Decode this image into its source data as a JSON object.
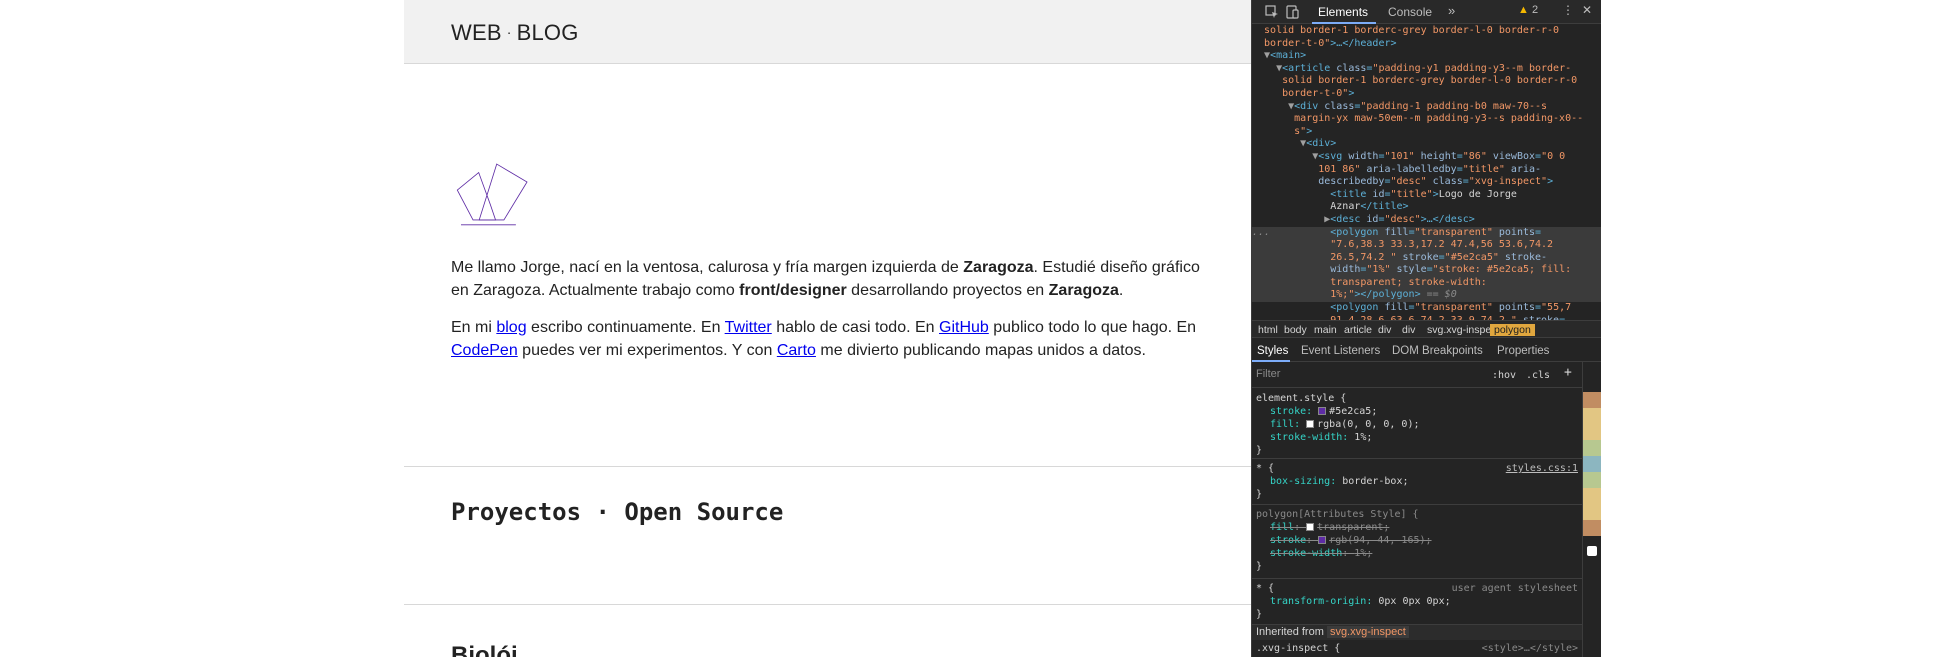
{
  "site": {
    "title_left": "WEB",
    "title_dot": "·",
    "title_right": "BLOG"
  },
  "logo": {
    "name": "Logo de Jorge Aznar",
    "stroke_color": "#5e2ca5"
  },
  "intro": {
    "p1": [
      {
        "t": "Me llamo Jorge, nací en la ventosa, calurosa y fría margen izquierda de "
      },
      {
        "t": "Zaragoza",
        "b": true
      },
      {
        "t": ". Estudié diseño gráfico en Zaragoza. Actualmente trabajo como "
      },
      {
        "t": "front/designer",
        "b": true
      },
      {
        "t": " desarrollando proyectos en "
      },
      {
        "t": "Zaragoza",
        "b": true
      },
      {
        "t": "."
      }
    ],
    "p2": [
      {
        "t": "En mi "
      },
      {
        "t": "blog",
        "link": true
      },
      {
        "t": " escribo continuamente. En "
      },
      {
        "t": "Twitter",
        "link": true
      },
      {
        "t": " hablo de casi todo. En "
      },
      {
        "t": "GitHub",
        "link": true
      },
      {
        "t": " publico todo lo que hago. En "
      },
      {
        "t": "CodePen",
        "link": true
      },
      {
        "t": " puedes ver mi experimentos. Y con "
      },
      {
        "t": "Carto",
        "link": true
      },
      {
        "t": " me divierto publicando mapas unidos a datos."
      }
    ]
  },
  "sections": {
    "projects_title": "Proyectos · Open Source",
    "next_title": "Biolói"
  },
  "devtools": {
    "tabs": {
      "elements": "Elements",
      "console": "Console",
      "more": "»",
      "warnings": "2",
      "kebab": "⋮",
      "close": "✕"
    },
    "dom_lines": [
      [
        {
          "c": "aval",
          "t": "  solid border-1 borderc-grey border-l-0 border-r-0"
        }
      ],
      [
        {
          "c": "aval",
          "t": "  border-t-0\""
        },
        {
          "c": "tag",
          "t": ">…</header>"
        }
      ],
      [
        {
          "c": "tri2",
          "t": "  ▼"
        },
        {
          "c": "tag",
          "t": "<main>"
        }
      ],
      [
        {
          "c": "tri2",
          "t": "    ▼"
        },
        {
          "c": "tag",
          "t": "<article "
        },
        {
          "c": "attr",
          "t": "class"
        },
        {
          "c": "tag",
          "t": "="
        },
        {
          "c": "aval",
          "t": "\"padding-y1 padding-y3--m border-"
        }
      ],
      [
        {
          "c": "aval",
          "t": "     solid border-1 borderc-grey border-l-0 border-r-0"
        }
      ],
      [
        {
          "c": "aval",
          "t": "     border-t-0\""
        },
        {
          "c": "tag",
          "t": ">"
        }
      ],
      [
        {
          "c": "tri2",
          "t": "      ▼"
        },
        {
          "c": "tag",
          "t": "<div "
        },
        {
          "c": "attr",
          "t": "class"
        },
        {
          "c": "tag",
          "t": "="
        },
        {
          "c": "aval",
          "t": "\"padding-1 padding-b0 maw-70--s"
        }
      ],
      [
        {
          "c": "aval",
          "t": "       margin-yx maw-50em--m padding-y3--s padding-x0--"
        }
      ],
      [
        {
          "c": "aval",
          "t": "       s\""
        },
        {
          "c": "tag",
          "t": ">"
        }
      ],
      [
        {
          "c": "tri2",
          "t": "        ▼"
        },
        {
          "c": "tag",
          "t": "<div>"
        }
      ],
      [
        {
          "c": "tri2",
          "t": "          ▼"
        },
        {
          "c": "tag",
          "t": "<svg "
        },
        {
          "c": "attr",
          "t": "width"
        },
        {
          "c": "tag",
          "t": "="
        },
        {
          "c": "aval",
          "t": "\"101\" "
        },
        {
          "c": "attr",
          "t": "height"
        },
        {
          "c": "tag",
          "t": "="
        },
        {
          "c": "aval",
          "t": "\"86\" "
        },
        {
          "c": "attr",
          "t": "viewBox"
        },
        {
          "c": "tag",
          "t": "="
        },
        {
          "c": "aval",
          "t": "\"0 0"
        }
      ],
      [
        {
          "c": "aval",
          "t": "           101 86\" "
        },
        {
          "c": "attr",
          "t": "aria-labelledby"
        },
        {
          "c": "tag",
          "t": "="
        },
        {
          "c": "aval",
          "t": "\"title\" "
        },
        {
          "c": "attr",
          "t": "aria-"
        }
      ],
      [
        {
          "c": "attr",
          "t": "           describedby"
        },
        {
          "c": "tag",
          "t": "="
        },
        {
          "c": "aval",
          "t": "\"desc\" "
        },
        {
          "c": "attr",
          "t": "class"
        },
        {
          "c": "tag",
          "t": "="
        },
        {
          "c": "aval",
          "t": "\"xvg-inspect\""
        },
        {
          "c": "tag",
          "t": ">"
        }
      ],
      [
        {
          "c": "tag",
          "t": "             <title "
        },
        {
          "c": "attr",
          "t": "id"
        },
        {
          "c": "tag",
          "t": "="
        },
        {
          "c": "aval",
          "t": "\"title\""
        },
        {
          "c": "tag",
          "t": ">"
        },
        {
          "c": "txt",
          "t": "Logo de Jorge"
        }
      ],
      [
        {
          "c": "txt",
          "t": "             Aznar"
        },
        {
          "c": "tag",
          "t": "</title>"
        }
      ],
      [
        {
          "c": "tri2",
          "t": "            ▶"
        },
        {
          "c": "tag",
          "t": "<desc "
        },
        {
          "c": "attr",
          "t": "id"
        },
        {
          "c": "tag",
          "t": "="
        },
        {
          "c": "aval",
          "t": "\"desc\""
        },
        {
          "c": "tag",
          "t": ">…</desc>"
        }
      ],
      [
        {
          "c": "dim",
          "t": "...          "
        },
        {
          "c": "tag",
          "t": "<polygon "
        },
        {
          "c": "attr",
          "t": "fill"
        },
        {
          "c": "tag",
          "t": "="
        },
        {
          "c": "aval",
          "t": "\"transparent\" "
        },
        {
          "c": "attr",
          "t": "points"
        },
        {
          "c": "tag",
          "t": "="
        }
      ],
      [
        {
          "c": "aval",
          "t": "             \"7.6,38.3 33.3,17.2 47.4,56 53.6,74.2"
        }
      ],
      [
        {
          "c": "aval",
          "t": "             26.5,74.2 \" "
        },
        {
          "c": "attr",
          "t": "stroke"
        },
        {
          "c": "tag",
          "t": "="
        },
        {
          "c": "aval",
          "t": "\"#5e2ca5\" "
        },
        {
          "c": "attr",
          "t": "stroke-"
        }
      ],
      [
        {
          "c": "attr",
          "t": "             width"
        },
        {
          "c": "tag",
          "t": "="
        },
        {
          "c": "aval",
          "t": "\"1%\" "
        },
        {
          "c": "attr",
          "t": "style"
        },
        {
          "c": "tag",
          "t": "="
        },
        {
          "c": "aval",
          "t": "\"stroke: #5e2ca5; fill:"
        }
      ],
      [
        {
          "c": "aval",
          "t": "             transparent; stroke-width:"
        }
      ],
      [
        {
          "c": "aval",
          "t": "             1%;\""
        },
        {
          "c": "tag",
          "t": "></polygon>"
        },
        {
          "c": "dim",
          "t": " == $0"
        }
      ],
      [
        {
          "c": "tag",
          "t": "             <polygon "
        },
        {
          "c": "attr",
          "t": "fill"
        },
        {
          "c": "tag",
          "t": "="
        },
        {
          "c": "aval",
          "t": "\"transparent\" "
        },
        {
          "c": "attr",
          "t": "points"
        },
        {
          "c": "tag",
          "t": "="
        },
        {
          "c": "aval",
          "t": "\"55,7"
        }
      ],
      [
        {
          "c": "aval",
          "t": "             91.4,28.6 63.6,74.2 33.9,74.2 \" "
        },
        {
          "c": "attr",
          "t": "stroke"
        },
        {
          "c": "tag",
          "t": "="
        }
      ]
    ],
    "breadcrumbs": [
      "html",
      "body",
      "main",
      "article",
      "div",
      "div",
      "svg.xvg-inspect",
      "polygon"
    ],
    "styles_tabs": [
      "Styles",
      "Event Listeners",
      "DOM Breakpoints",
      "Properties"
    ],
    "filter_placeholder": "Filter",
    "hov": ":hov",
    "cls": ".cls",
    "plus": "+",
    "rules": {
      "element_style": {
        "selector": "element.style {",
        "props": [
          {
            "name": "stroke",
            "value": "#5e2ca5;",
            "swatch": "#5e2ca5"
          },
          {
            "name": "fill",
            "value": "rgba(0, 0, 0, 0);",
            "swatch": "#ffffff"
          },
          {
            "name": "stroke-width",
            "value": "1%;"
          }
        ]
      },
      "universal": {
        "selector": "* {",
        "source": "styles.css:1",
        "props": [
          {
            "name": "box-sizing",
            "value": "border-box;"
          }
        ]
      },
      "polygon_attr": {
        "selector": "polygon[Attributes Style] {",
        "props": [
          {
            "name": "fill",
            "value": "transparent;",
            "swatch": "#ffffff"
          },
          {
            "name": "stroke",
            "value": "rgb(94, 44, 165);",
            "swatch": "#5e2ca5"
          },
          {
            "name": "stroke-width",
            "value": "1%;"
          }
        ]
      },
      "user_agent": {
        "selector": "* {",
        "source": "user agent stylesheet",
        "props": [
          {
            "name": "transform-origin",
            "value": "0px 0px 0px;"
          }
        ]
      },
      "close": "}"
    },
    "inherited_label": "Inherited from",
    "inherited_selector": "svg.xvg-inspect",
    "next_rule_selector": ".xvg-inspect {",
    "next_rule_source": "<style>…</style>"
  }
}
